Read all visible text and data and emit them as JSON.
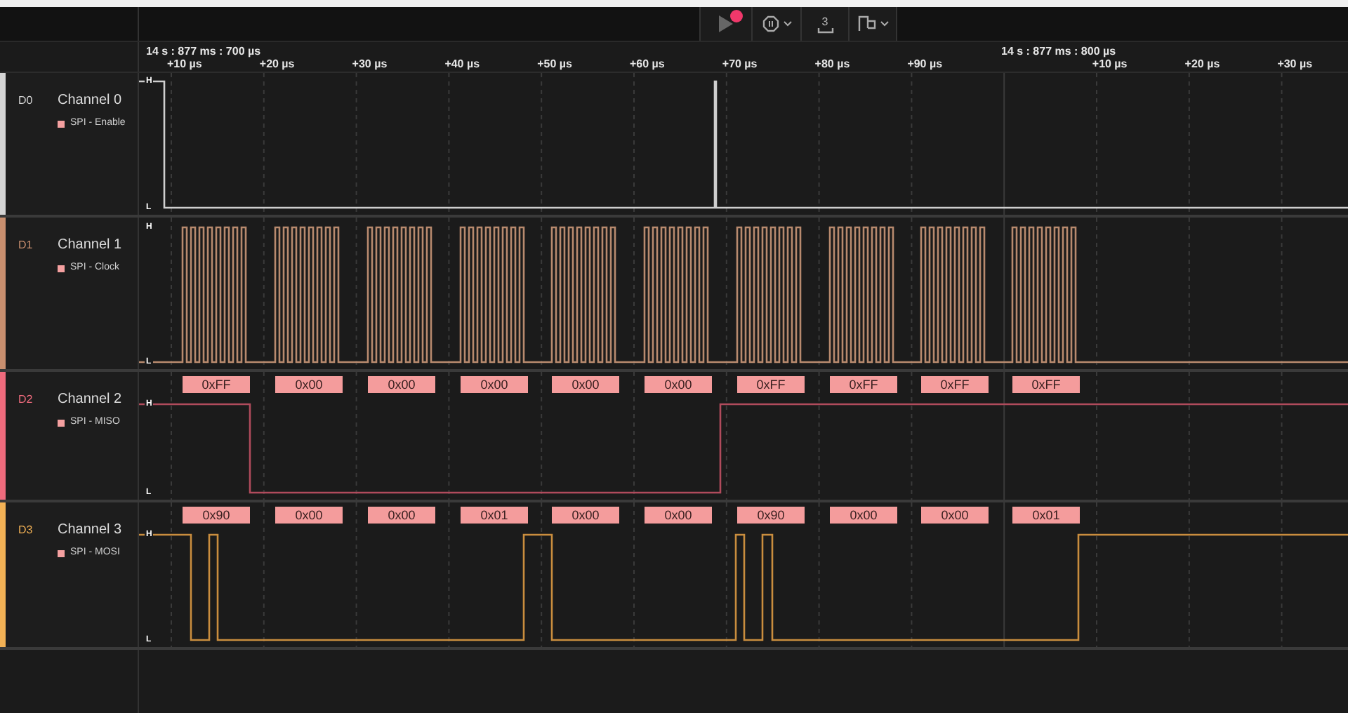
{
  "toolbar": {
    "measure_label": "3"
  },
  "timeline": {
    "segments": [
      {
        "time": "14 s : 877 ms : 700 µs",
        "ticks": [
          "+10 µs",
          "+20 µs",
          "+30 µs",
          "+40 µs",
          "+50 µs",
          "+60 µs",
          "+70 µs",
          "+80 µs",
          "+90 µs"
        ]
      },
      {
        "time": "14 s : 877 ms : 800 µs",
        "ticks": [
          "+10 µs",
          "+20 µs",
          "+30 µs"
        ]
      }
    ]
  },
  "channels": [
    {
      "id": "D0",
      "name": "Channel 0",
      "color": "#d4d4d4",
      "analyzer": "SPI - Enable",
      "high": "H",
      "low": "L"
    },
    {
      "id": "D1",
      "name": "Channel 1",
      "color": "#c98f6f",
      "analyzer": "SPI - Clock",
      "high": "H",
      "low": "L"
    },
    {
      "id": "D2",
      "name": "Channel 2",
      "color": "#ef6b7d",
      "analyzer": "SPI - MISO",
      "high": "H",
      "low": "L",
      "decoded": [
        "0xFF",
        "0x00",
        "0x00",
        "0x00",
        "0x00",
        "0x00",
        "0xFF",
        "0xFF",
        "0xFF",
        "0xFF"
      ]
    },
    {
      "id": "D3",
      "name": "Channel 3",
      "color": "#f2b155",
      "analyzer": "SPI - MOSI",
      "high": "H",
      "low": "L",
      "decoded": [
        "0x90",
        "0x00",
        "0x00",
        "0x01",
        "0x00",
        "0x00",
        "0x90",
        "0x00",
        "0x00",
        "0x01"
      ]
    }
  ]
}
